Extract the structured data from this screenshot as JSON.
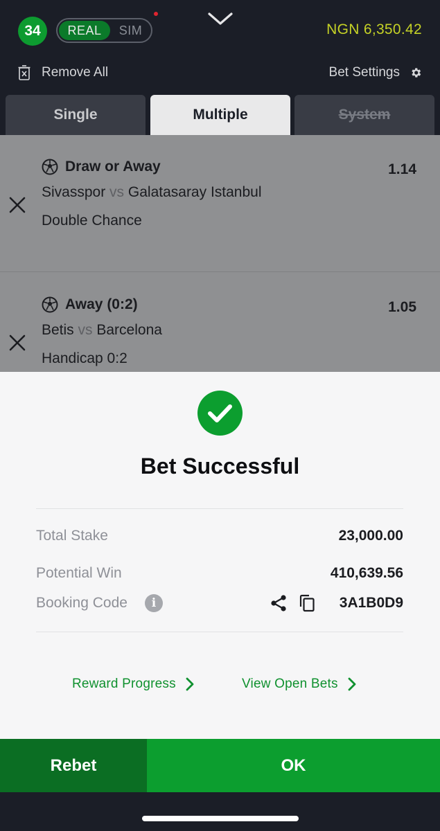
{
  "header": {
    "count_badge": "34",
    "mode_real": "REAL",
    "mode_sim": "SIM",
    "balance": "NGN 6,350.42",
    "remove_all": "Remove All",
    "bet_settings": "Bet Settings"
  },
  "tabs": [
    {
      "label": "Single"
    },
    {
      "label": "Multiple"
    },
    {
      "label": "System"
    }
  ],
  "bets": [
    {
      "selection": "Draw or Away",
      "odds": "1.14",
      "home": "Sivasspor",
      "vs": "vs",
      "away": "Galatasaray Istanbul",
      "market": "Double Chance"
    },
    {
      "selection": "Away (0:2)",
      "odds": "1.05",
      "home": "Betis",
      "vs": "vs",
      "away": "Barcelona",
      "market": "Handicap 0:2"
    }
  ],
  "result": {
    "title": "Bet Successful",
    "total_stake_label": "Total Stake",
    "total_stake_value": "23,000.00",
    "potential_win_label": "Potential Win",
    "potential_win_value": "410,639.56",
    "booking_code_label": "Booking Code",
    "booking_code_value": "3A1B0D9",
    "info_glyph": "i",
    "reward_progress": "Reward Progress",
    "view_open_bets": "View Open Bets"
  },
  "footer": {
    "rebet": "Rebet",
    "ok": "OK"
  },
  "colors": {
    "brand_green": "#0c9e2f",
    "dark_green": "#0b6e23",
    "balance_yellow": "#c5d226",
    "background": "#1b1e27"
  }
}
